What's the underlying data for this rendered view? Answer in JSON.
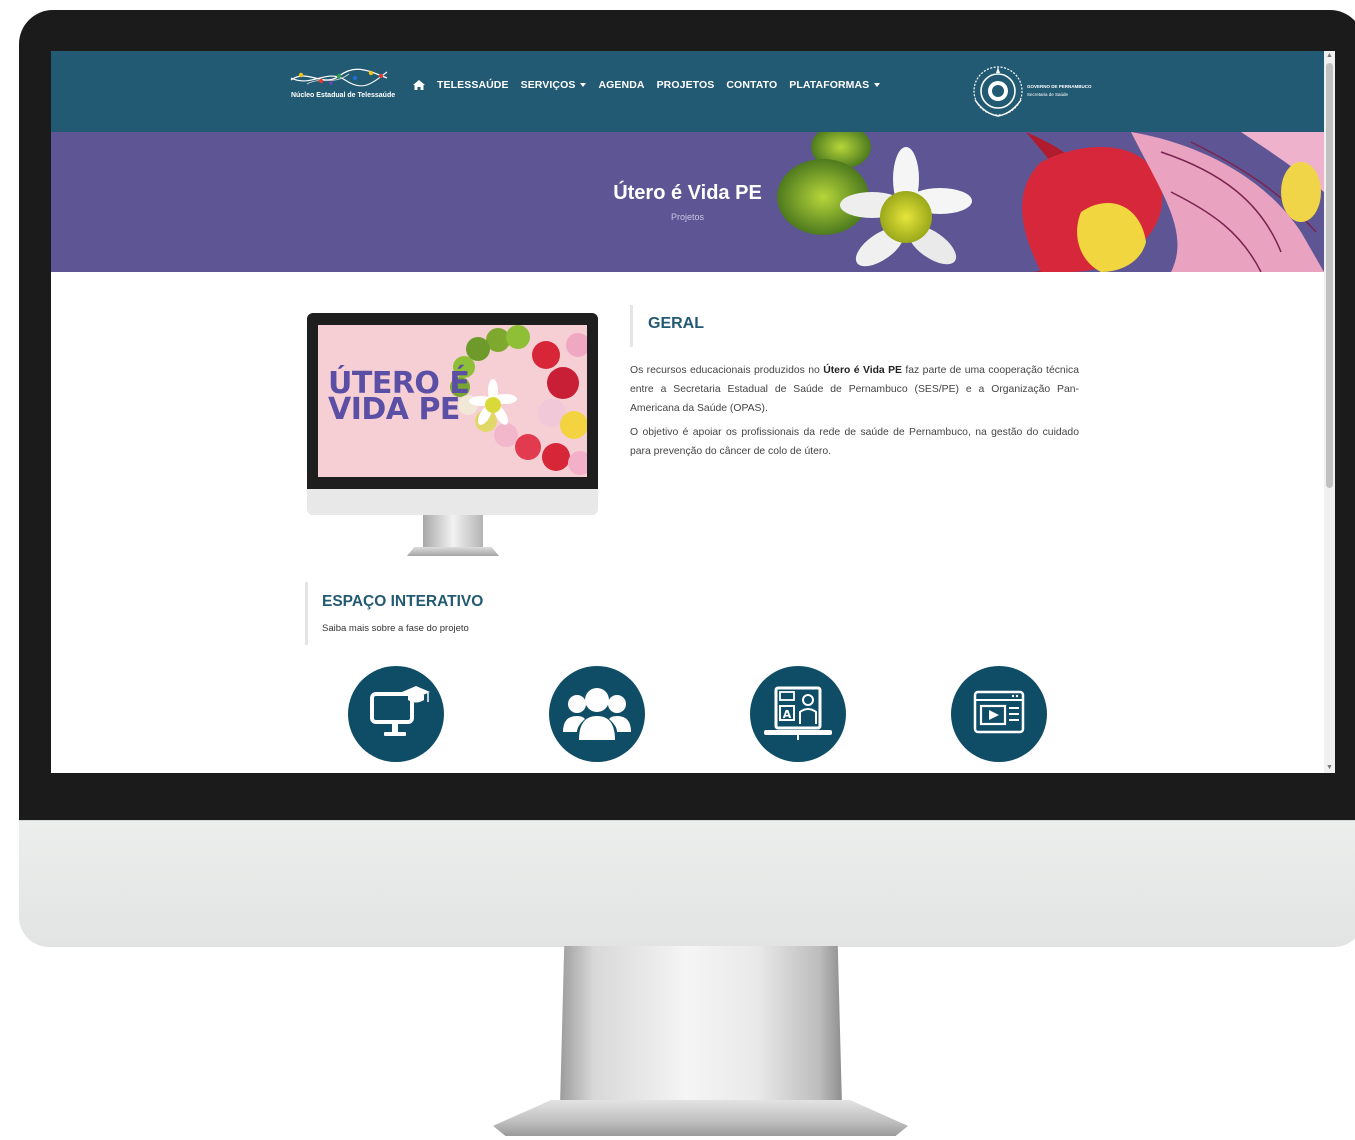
{
  "header": {
    "logo_text": "Núcleo Estadual de Telessaúde",
    "nav": [
      {
        "label": "",
        "icon": "home-icon"
      },
      {
        "label": "TELESSAÚDE"
      },
      {
        "label": "SERVIÇOS",
        "dropdown": true
      },
      {
        "label": "AGENDA"
      },
      {
        "label": "PROJETOS"
      },
      {
        "label": "CONTATO"
      },
      {
        "label": "PLATAFORMAS",
        "dropdown": true
      }
    ],
    "gov_line1": "GOVERNO DE PERNAMBUCO",
    "gov_line2": "Secretaria de Saúde"
  },
  "hero": {
    "title": "Útero é Vida PE",
    "breadcrumb": "Projetos"
  },
  "project_image": {
    "line1": "ÚTERO É",
    "line2": "VIDA PE"
  },
  "geral": {
    "title": "GERAL",
    "p1_before": "Os recursos educacionais produzidos no ",
    "p1_bold": "Útero é Vida PE",
    "p1_after": " faz parte de uma cooperação técnica entre a Secretaria Estadual de Saúde de Pernambuco (SES/PE) e a Organização Pan-Americana da Saúde (OPAS).",
    "p2": "O objetivo é apoiar os profissionais da rede de saúde de Pernambuco, na gestão do cuidado para prevenção do câncer de colo de útero."
  },
  "espaco": {
    "title": "ESPAÇO INTERATIVO",
    "subtitle": "Saiba mais sobre a fase do projeto"
  },
  "icons": [
    "monitor-graduation-icon",
    "group-users-icon",
    "online-teacher-icon",
    "video-player-icon"
  ],
  "colors": {
    "header_bg": "#235a73",
    "hero_bg": "#5e5694",
    "accent": "#235a73",
    "icon_circle": "#0f4d66"
  }
}
